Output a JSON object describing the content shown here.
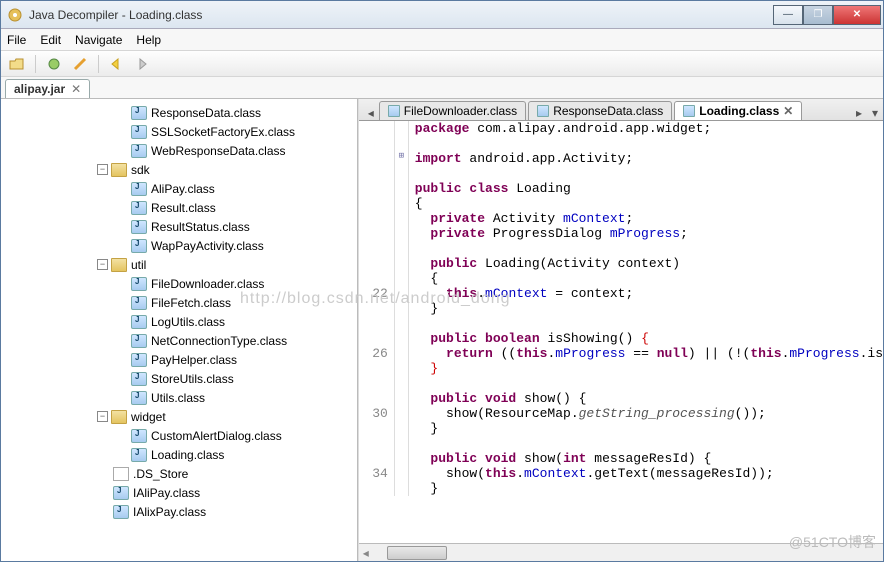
{
  "window": {
    "title": "Java Decompiler - Loading.class"
  },
  "menu": {
    "file": "File",
    "edit": "Edit",
    "navigate": "Navigate",
    "help": "Help"
  },
  "jartab": {
    "name": "alipay.jar"
  },
  "tree": {
    "top": [
      {
        "label": "ResponseData.class"
      },
      {
        "label": "SSLSocketFactoryEx.class"
      },
      {
        "label": "WebResponseData.class"
      }
    ],
    "pkg_sdk": {
      "label": "sdk",
      "children": [
        {
          "label": "AliPay.class"
        },
        {
          "label": "Result.class"
        },
        {
          "label": "ResultStatus.class"
        },
        {
          "label": "WapPayActivity.class"
        }
      ]
    },
    "pkg_util": {
      "label": "util",
      "children": [
        {
          "label": "FileDownloader.class"
        },
        {
          "label": "FileFetch.class"
        },
        {
          "label": "LogUtils.class"
        },
        {
          "label": "NetConnectionType.class"
        },
        {
          "label": "PayHelper.class"
        },
        {
          "label": "StoreUtils.class"
        },
        {
          "label": "Utils.class"
        }
      ]
    },
    "pkg_widget": {
      "label": "widget",
      "children": [
        {
          "label": "CustomAlertDialog.class"
        },
        {
          "label": "Loading.class"
        }
      ]
    },
    "others": [
      {
        "label": ".DS_Store",
        "type": "file"
      },
      {
        "label": "IAliPay.class"
      },
      {
        "label": "IAlixPay.class"
      }
    ]
  },
  "editor_tabs": {
    "t1": "FileDownloader.class",
    "t2": "ResponseData.class",
    "t3": "Loading.class"
  },
  "code": {
    "l1": "package com.alipay.android.app.widget;",
    "l3": "import android.app.Activity;",
    "l5a": "public class Loading",
    "l6": "{",
    "l7": "  private Activity mContext;",
    "l8": "  private ProgressDialog mProgress;",
    "l10": "  public Loading(Activity context)",
    "l11": "  {",
    "l12_num": "22",
    "l12": "    this.mContext = context;",
    "l13": "  }",
    "l15": "  public boolean isShowing() {",
    "l16_num": "26",
    "l16": "    return ((this.mProgress == null) || (!(this.mProgress.is",
    "l17": "  }",
    "l19": "  public void show() {",
    "l20_num": "30",
    "l20": "    show(ResourceMap.getString_processing());",
    "l21": "  }",
    "l23": "  public void show(int messageResId) {",
    "l24_num": "34",
    "l24": "    show(this.mContext.getText(messageResId));",
    "l25": "  }"
  },
  "watermark": "@51CTO博客",
  "watermark2": "http://blog.csdn.net/android_dong"
}
